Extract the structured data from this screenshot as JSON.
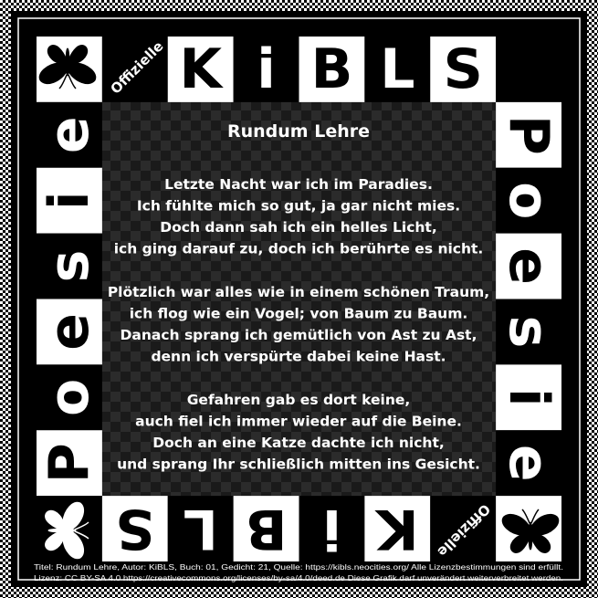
{
  "poem": {
    "title": "Rundum Lehre",
    "lines": [
      "Letzte Nacht war ich im Paradies.",
      "Ich fühlte mich so gut, ja gar nicht mies.",
      "Doch dann sah ich ein helles Licht,",
      "ich ging darauf zu, doch ich berührte es nicht.",
      "",
      "Plötzlich war alles wie in einem schönen Traum,",
      "ich flog wie ein Vogel; von Baum zu Baum.",
      "Danach sprang ich gemütlich von Ast zu Ast,",
      "denn ich verspürte dabei keine Hast.",
      "",
      "Gefahren gab es dort keine,",
      "auch fiel ich immer wieder auf die Beine.",
      "Doch an eine Katze dachte ich nicht,",
      "und sprang Ihr schließlich mitten ins Gesicht."
    ]
  },
  "frame": {
    "top_letters": [
      "K",
      "i",
      "B",
      "L",
      "S"
    ],
    "bottom_letters": [
      "S",
      "L",
      "B",
      "i",
      "K"
    ],
    "left_letters": [
      "e",
      "i",
      "s",
      "e",
      "o",
      "P"
    ],
    "right_letters": [
      "P",
      "o",
      "e",
      "s",
      "i",
      "e"
    ],
    "badge_top": "Offizielle",
    "badge_bottom": "Offizielle",
    "corner_icon": "butterfly-icon"
  },
  "footer": {
    "line1": "Titel: Rundum Lehre, Autor: KiBLS, Buch: 01, Gedicht: 21, Quelle: https://kibls.neocities.org/ Alle Lizenzbestimmungen sind erfüllt.",
    "line2": "Lizenz: CC BY-SA 4.0 https://creativecommons.org/licenses/by-sa/4.0/deed.de Diese Grafik darf unverändert weiterverbreitet werden."
  },
  "colors": {
    "black": "#000000",
    "white": "#ffffff",
    "check_dark": "#1a1a1a",
    "check_light": "#2b2b2b"
  }
}
